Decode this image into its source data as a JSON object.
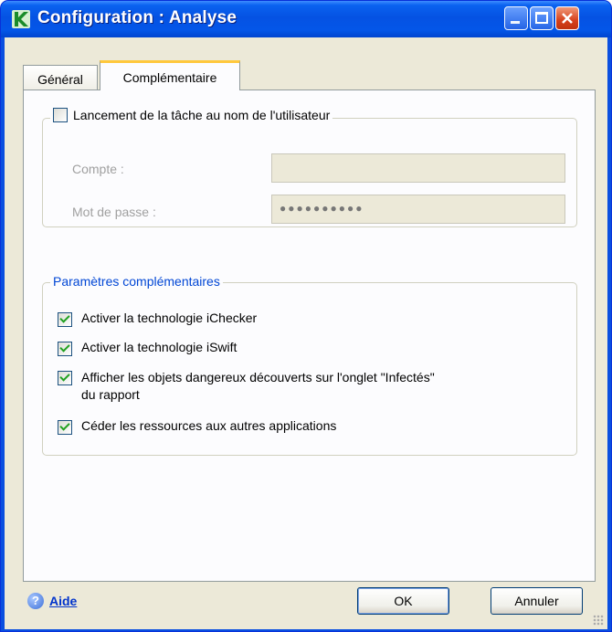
{
  "window": {
    "title": "Configuration : Analyse"
  },
  "tabs": [
    {
      "label": "Général",
      "active": false
    },
    {
      "label": "Complémentaire",
      "active": true
    }
  ],
  "user_group": {
    "checkbox_label": "Lancement de la tâche au nom de l'utilisateur",
    "checked": false,
    "account_label": "Compte :",
    "account_value": "",
    "password_label": "Mot de passe :",
    "password_value": "●●●●●●●●●●"
  },
  "extra_group": {
    "title": "Paramètres complémentaires",
    "options": [
      {
        "label": "Activer la technologie iChecker",
        "checked": true
      },
      {
        "label": "Activer la technologie iSwift",
        "checked": true
      },
      {
        "label_line1": "Afficher les objets dangereux découverts sur l'onglet \"Infectés\"",
        "label_line2": "du rapport",
        "checked": true
      },
      {
        "label": "Céder les ressources aux autres applications",
        "checked": true
      }
    ]
  },
  "footer": {
    "help_label": "Aide",
    "ok_label": "OK",
    "cancel_label": "Annuler"
  },
  "colors": {
    "titlebar": "#0552e3",
    "accent_tab": "#ffc83c",
    "group_title": "#0046d5"
  }
}
